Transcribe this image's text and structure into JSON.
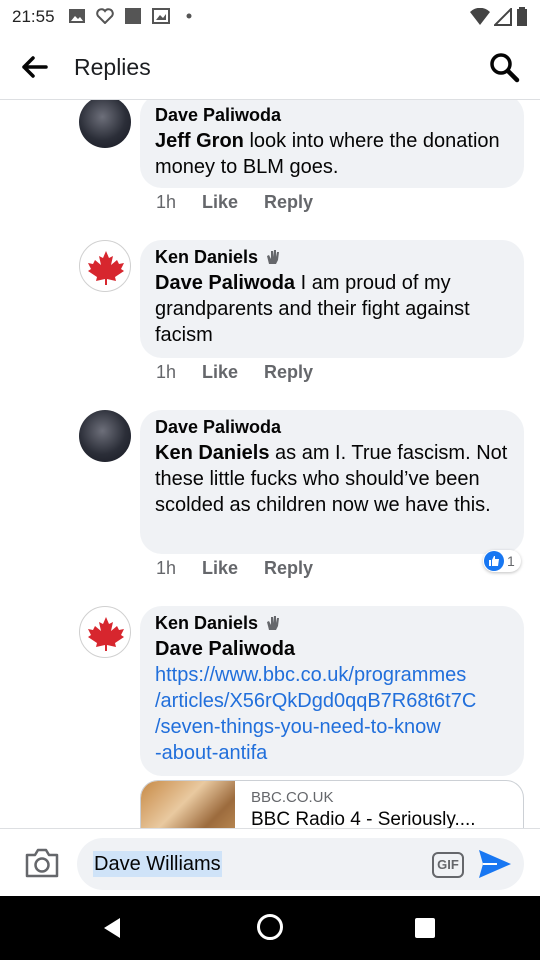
{
  "status_bar": {
    "time": "21:55"
  },
  "header": {
    "title": "Replies"
  },
  "comments": [
    {
      "author": "Dave Paliwoda",
      "mention": "Jeff Gron",
      "text": " look into where the donation money to BLM goes.",
      "time": "1h",
      "like": "Like",
      "reply": "Reply"
    },
    {
      "author": "Ken Daniels",
      "mention": "Dave Paliwoda",
      "text": " I am proud of my grandparents and their fight against facism",
      "time": "1h",
      "like": "Like",
      "reply": "Reply"
    },
    {
      "author": "Dave Paliwoda",
      "mention": "Ken Daniels",
      "text": " as am I. True fascism. Not these little fucks who should’ve been scolded as children now we have this.",
      "time": "1h",
      "like": "Like",
      "reply": "Reply",
      "reaction_count": "1"
    },
    {
      "author": "Ken Daniels",
      "mention": "Dave Paliwoda",
      "link_lines": [
        "https://www.bbc.co.uk/programmes",
        "/articles/X56rQkDgd0qqB7R68t6t7C",
        "/seven-things-you-need-to-know",
        "-about-antifa"
      ]
    }
  ],
  "link_preview": {
    "domain": "BBC.CO.UK",
    "title": "BBC Radio 4 - Seriously...."
  },
  "composer": {
    "input_value": "Dave Williams",
    "gif_label": "GIF"
  },
  "colors": {
    "link": "#216fdb",
    "send": "#1877f2",
    "bubble": "#f0f2f5"
  },
  "icons": [
    "back-arrow-icon",
    "search-icon",
    "camera-icon",
    "gif-icon",
    "send-icon",
    "like-icon",
    "gesture-icon"
  ]
}
